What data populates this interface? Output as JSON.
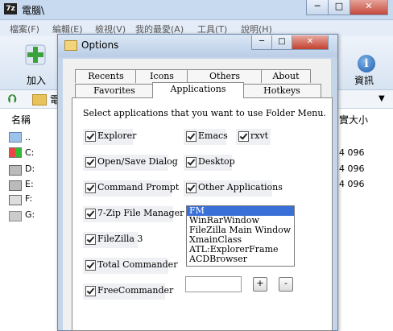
{
  "bg_window": {
    "title": "電腦\\",
    "app_icon_text": "7z",
    "menu": [
      "檔案(F)",
      "編輯(E)",
      "檢視(V)",
      "我的最愛(A)",
      "工具(T)",
      "說明(H)"
    ],
    "toolbar": {
      "add_label": "加入",
      "info_label": "資訊"
    },
    "path_char": "電",
    "columns": {
      "name": "名稱",
      "size": "實大小"
    },
    "rows": [
      {
        "label": "..",
        "size": ""
      },
      {
        "label": "C:",
        "size": "4 096"
      },
      {
        "label": "D:",
        "size": "4 096"
      },
      {
        "label": "E:",
        "size": "4 096"
      },
      {
        "label": "F:",
        "size": ""
      },
      {
        "label": "G:",
        "size": ""
      }
    ]
  },
  "dialog": {
    "title": "Options",
    "tabs_row1": [
      "Recents",
      "Icons",
      "Others",
      "About"
    ],
    "tabs_row2": [
      "Favorites",
      "Applications",
      "Hotkeys"
    ],
    "active_tab": "Applications",
    "instruction": "Select applications that you want to use Folder Menu.",
    "checkboxes_left": [
      "Explorer",
      "Open/Save Dialog",
      "Command Prompt",
      "7-Zip File Manager",
      "FileZilla 3",
      "Total Commander",
      "FreeCommander"
    ],
    "checkboxes_right": [
      "Emacs",
      "Desktop",
      "Other Applications"
    ],
    "checkbox_extra": "rxvt",
    "class_list": [
      "FM",
      "WinRarWindow",
      "FileZilla Main Window",
      "XmainClass",
      "ATL:ExplorerFrame",
      "ACDBrowser"
    ],
    "selected_class": "FM",
    "add_button": "+",
    "remove_button": "-",
    "class_input_value": ""
  }
}
